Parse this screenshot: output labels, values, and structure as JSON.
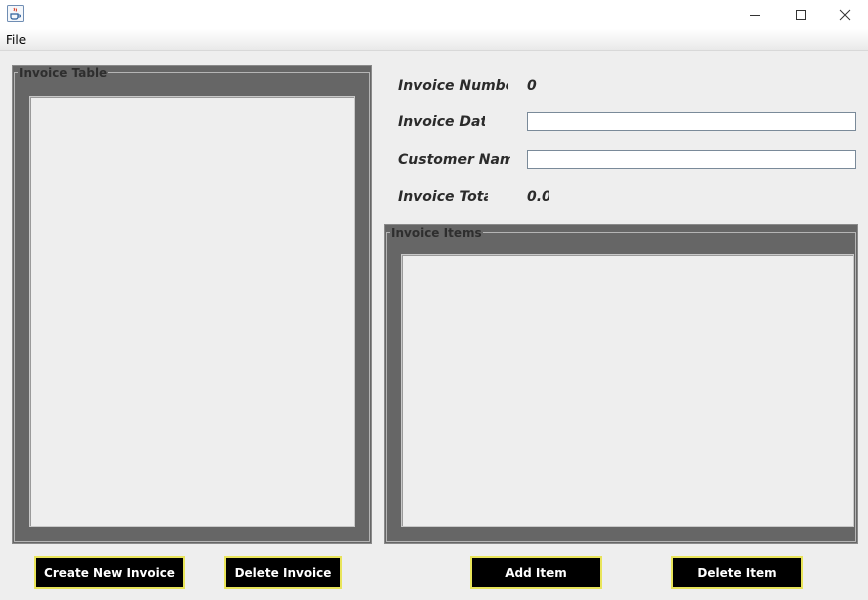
{
  "window": {
    "icon": "java-coffee-icon",
    "controls": [
      "minimize-icon",
      "maximize-icon",
      "close-icon"
    ]
  },
  "menu": {
    "file_label": "File"
  },
  "invoice_table": {
    "title": "Invoice Table"
  },
  "form": {
    "invoice_number_label": "Invoice Number",
    "invoice_number_value": "0",
    "invoice_date_label": "Invoice Date",
    "invoice_date_value": "",
    "customer_name_label": "Customer Name",
    "customer_name_value": "",
    "invoice_total_label": "Invoice Total",
    "invoice_total_value": "0.0"
  },
  "invoice_items": {
    "title": "Invoice Items"
  },
  "buttons": {
    "create_invoice": "Create New Invoice",
    "delete_invoice": "Delete Invoice",
    "add_item": "Add Item",
    "delete_item": "Delete Item"
  },
  "colors": {
    "panel_bg": "#666666",
    "window_bg": "#eeeeee",
    "button_bg": "#000000",
    "button_border": "#e8e45a"
  }
}
